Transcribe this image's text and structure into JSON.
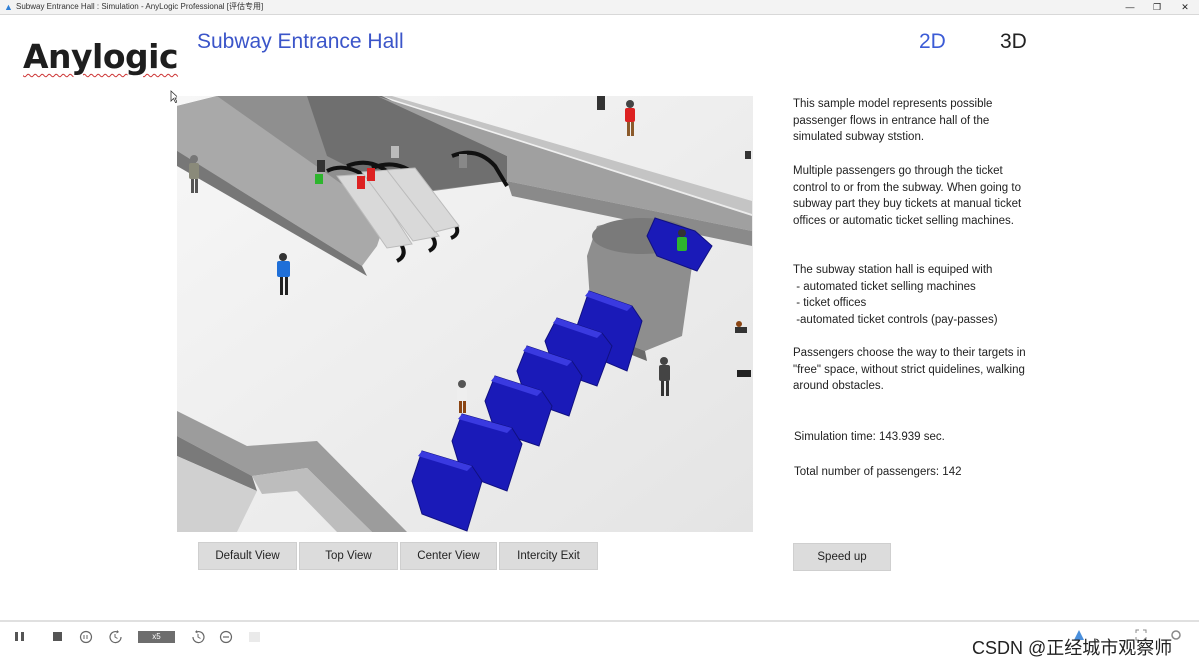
{
  "window": {
    "title": "Subway Entrance Hall : Simulation - AnyLogic Professional [评估专用]",
    "minimize_glyph": "—",
    "restore_glyph": "❐",
    "close_glyph": "✕"
  },
  "logo": "Anylogic",
  "header": {
    "title": "Subway Entrance Hall",
    "view_2d": "2D",
    "view_3d": "3D"
  },
  "description": {
    "p1": "This sample model represents possible passenger flows in entrance hall of the simulated subway ststion.",
    "p2": "Multiple passengers go through the ticket control to or from the subway. When going to subway part they buy tickets at manual ticket offices or automatic ticket selling machines.",
    "p3_intro": "The subway station hall is equiped with",
    "p3_items": [
      " - automated ticket selling machines",
      " - ticket offices",
      " -automated ticket controls (pay-passes)"
    ],
    "p4": "Passengers choose the way to their targets in \"free\" space, without strict quidelines, walking around obstacles."
  },
  "stats": {
    "simulation_time": "Simulation time: 143.939 sec.",
    "total_passengers": "Total number of passengers: 142"
  },
  "buttons": {
    "default_view": "Default View",
    "top_view": "Top View",
    "center_view": "Center View",
    "intercity_exit": "Intercity Exit",
    "speed_up": "Speed up"
  },
  "toolbar": {
    "speed_label": "x5",
    "icons": [
      "pause-icon",
      "stop-icon",
      "run-until-icon",
      "slow-down-icon",
      "speed-up-icon",
      "step-icon",
      "experiment-icon"
    ]
  },
  "watermark": "CSDN @正经城市观察师",
  "colors": {
    "title_blue": "#3b55c9",
    "gate_blue": "#1a1ab8",
    "button_gray": "#dcdcdc"
  }
}
